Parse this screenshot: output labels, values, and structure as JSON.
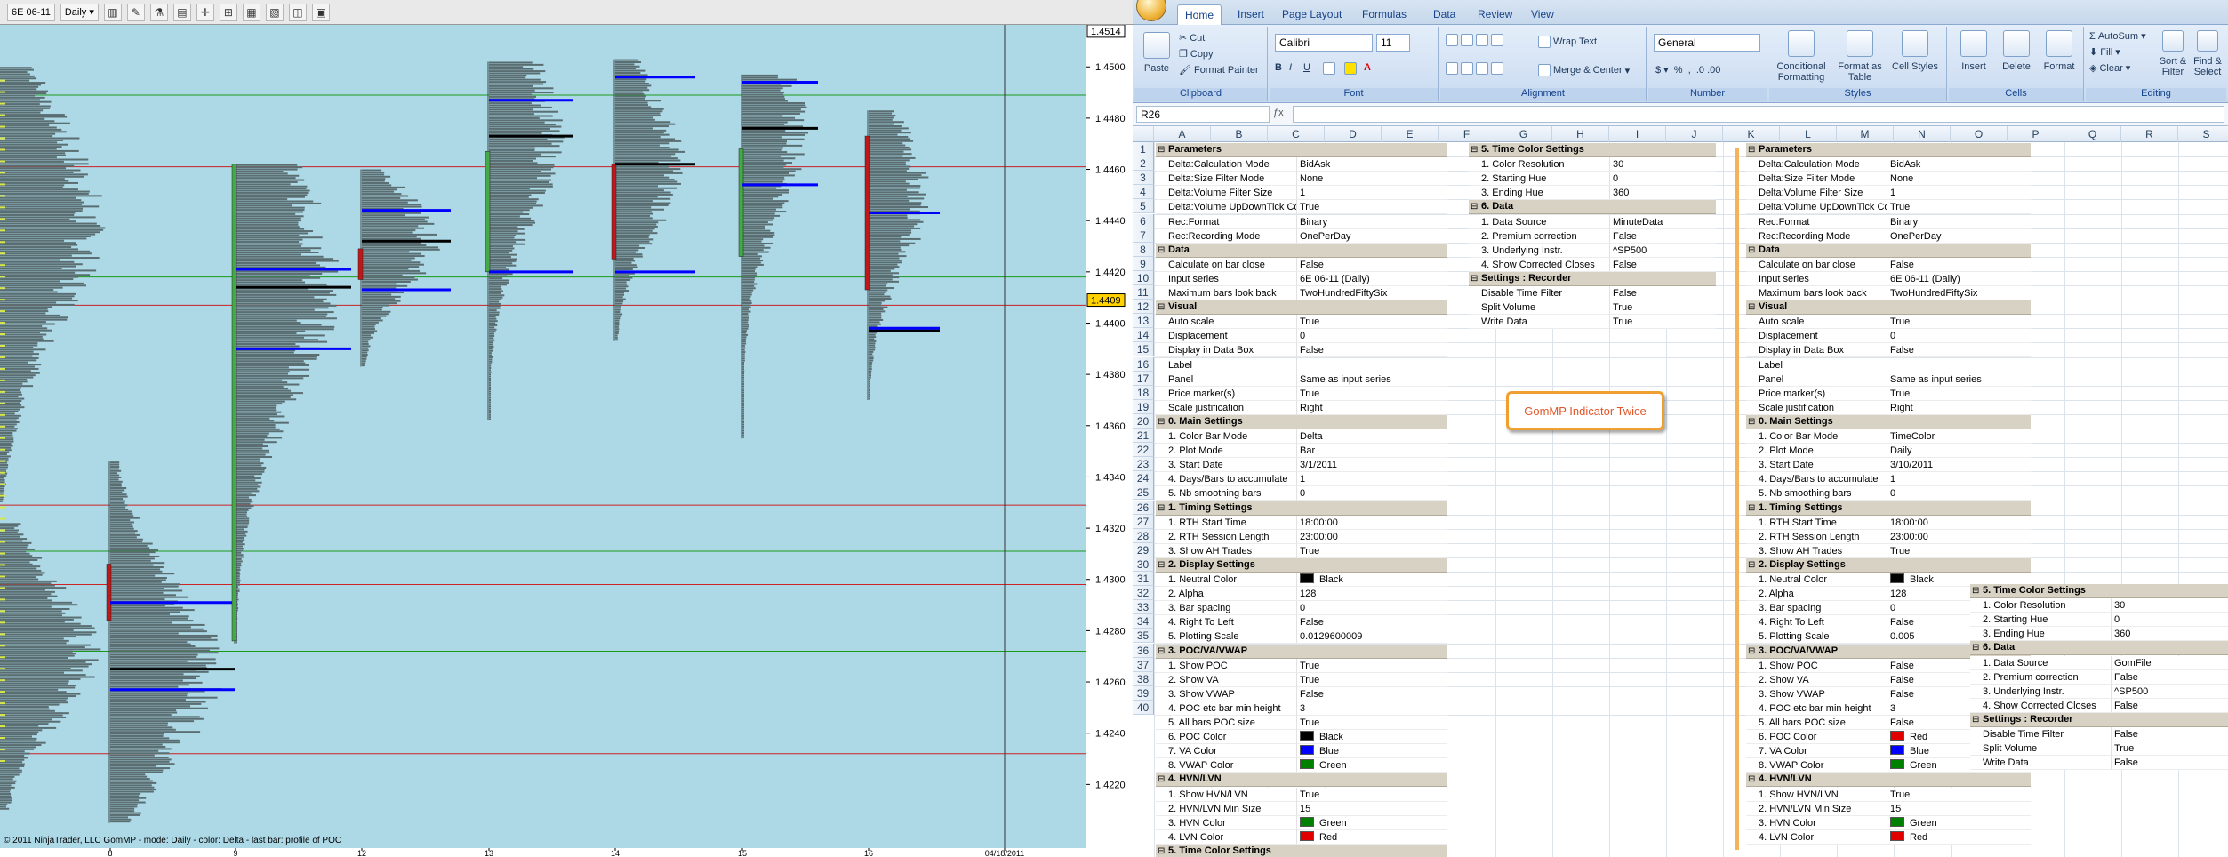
{
  "chart": {
    "instrument": "6E 06-11",
    "period": "Daily",
    "price_axis": [
      "1.4500",
      "1.4480",
      "1.4460",
      "1.4440",
      "1.4420",
      "1.4400",
      "1.4380",
      "1.4360",
      "1.4340",
      "1.4320",
      "1.4300",
      "1.4280",
      "1.4260",
      "1.4240",
      "1.4220"
    ],
    "last_price_top": "1.4514",
    "last_price_marker": "1.4409",
    "date_labels": [
      "8",
      "9",
      "12",
      "13",
      "14",
      "15",
      "16",
      "04/18/2011"
    ],
    "footer": "© 2011 NinjaTrader, LLC  GomMP - mode: Daily - color: Delta - last bar: profile of POC",
    "colors": {
      "plot_bg": "#add8e6",
      "profile": "#5a6e72",
      "poc": "#000000",
      "va": "#0000ff",
      "hline_red": "#cc2222",
      "hline_green": "#1a9a1a"
    }
  },
  "excel": {
    "tabs": [
      "Home",
      "Insert",
      "Page Layout",
      "Formulas",
      "Data",
      "Review",
      "View"
    ],
    "groups": {
      "clipboard": {
        "label": "Clipboard",
        "paste": "Paste",
        "cut": "Cut",
        "copy": "Copy",
        "format_painter": "Format Painter"
      },
      "font": {
        "label": "Font",
        "name": "Calibri",
        "size": "11"
      },
      "alignment": {
        "label": "Alignment",
        "wrap": "Wrap Text",
        "merge": "Merge & Center"
      },
      "number": {
        "label": "Number",
        "format": "General"
      },
      "styles": {
        "label": "Styles",
        "conditional": "Conditional Formatting",
        "format_table": "Format as Table",
        "cell_styles": "Cell Styles"
      },
      "cells": {
        "label": "Cells",
        "insert": "Insert",
        "delete": "Delete",
        "format": "Format"
      },
      "editing": {
        "label": "Editing",
        "autosum": "AutoSum",
        "fill": "Fill",
        "clear": "Clear",
        "sort": "Sort & Filter",
        "find": "Find & Select"
      }
    },
    "name_box": "R26",
    "columns": [
      "A",
      "B",
      "C",
      "D",
      "E",
      "F",
      "G",
      "H",
      "I",
      "J",
      "K",
      "L",
      "M",
      "N",
      "O",
      "P",
      "Q",
      "R",
      "S"
    ],
    "rows": [
      "1",
      "2",
      "3",
      "4",
      "5",
      "6",
      "7",
      "8",
      "9",
      "10",
      "11",
      "12",
      "13",
      "14",
      "15",
      "16",
      "17",
      "18",
      "19",
      "20",
      "21",
      "22",
      "23",
      "24",
      "25",
      "26",
      "27",
      "28",
      "29",
      "30",
      "31",
      "32",
      "33",
      "34",
      "35",
      "36",
      "37",
      "38",
      "39",
      "40"
    ],
    "callout": "GomMP Indicator Twice",
    "panel1": [
      {
        "s": "Parameters"
      },
      {
        "k": "Delta:Calculation Mode",
        "v": "BidAsk"
      },
      {
        "k": "Delta:Size Filter Mode",
        "v": "None"
      },
      {
        "k": "Delta:Volume Filter Size",
        "v": "1"
      },
      {
        "k": "Delta:Volume UpDownTick Com",
        "v": "True"
      },
      {
        "k": "Rec:Format",
        "v": "Binary"
      },
      {
        "k": "Rec:Recording Mode",
        "v": "OnePerDay"
      },
      {
        "s": "Data"
      },
      {
        "k": "Calculate on bar close",
        "v": "False"
      },
      {
        "k": "Input series",
        "v": "6E 06-11 (Daily)"
      },
      {
        "k": "Maximum bars look back",
        "v": "TwoHundredFiftySix"
      },
      {
        "s": "Visual"
      },
      {
        "k": "Auto scale",
        "v": "True"
      },
      {
        "k": "Displacement",
        "v": "0"
      },
      {
        "k": "Display in Data Box",
        "v": "False"
      },
      {
        "k": "Label",
        "v": ""
      },
      {
        "k": "Panel",
        "v": "Same as input series"
      },
      {
        "k": "Price marker(s)",
        "v": "True"
      },
      {
        "k": "Scale justification",
        "v": "Right"
      },
      {
        "s": "0. Main Settings"
      },
      {
        "k": "1. Color Bar Mode",
        "v": "Delta"
      },
      {
        "k": "2. Plot Mode",
        "v": "Bar"
      },
      {
        "k": "3. Start Date",
        "v": "3/1/2011"
      },
      {
        "k": "4. Days/Bars to accumulate",
        "v": "1"
      },
      {
        "k": "5. Nb smoothing bars",
        "v": "0"
      },
      {
        "s": "1. Timing Settings"
      },
      {
        "k": "1. RTH Start Time",
        "v": "18:00:00"
      },
      {
        "k": "2. RTH Session Length",
        "v": "23:00:00"
      },
      {
        "k": "3. Show AH Trades",
        "v": "True"
      },
      {
        "s": "2. Display Settings"
      },
      {
        "k": "1. Neutral Color",
        "v": "Black",
        "c": "#000000"
      },
      {
        "k": "2. Alpha",
        "v": "128"
      },
      {
        "k": "3. Bar spacing",
        "v": "0"
      },
      {
        "k": "4. Right To Left",
        "v": "False"
      },
      {
        "k": "5. Plotting Scale",
        "v": "0.0129600009"
      },
      {
        "s": "3. POC/VA/VWAP"
      },
      {
        "k": "1. Show POC",
        "v": "True"
      },
      {
        "k": "2. Show VA",
        "v": "True"
      },
      {
        "k": "3. Show VWAP",
        "v": "False"
      },
      {
        "k": "4. POC etc bar min height",
        "v": "3"
      },
      {
        "k": "5. All bars POC size",
        "v": "True"
      },
      {
        "k": "6. POC Color",
        "v": "Black",
        "c": "#000000"
      },
      {
        "k": "7. VA Color",
        "v": "Blue",
        "c": "#0000ff"
      },
      {
        "k": "8. VWAP Color",
        "v": "Green",
        "c": "#008000"
      },
      {
        "s": "4. HVN/LVN"
      },
      {
        "k": "1. Show HVN/LVN",
        "v": "True"
      },
      {
        "k": "2. HVN/LVN Min Size",
        "v": "15"
      },
      {
        "k": "3. HVN Color",
        "v": "Green",
        "c": "#008000"
      },
      {
        "k": "4. LVN Color",
        "v": "Red",
        "c": "#e00000"
      },
      {
        "s": "5. Time Color Settings"
      }
    ],
    "panel2": [
      {
        "s": "5. Time Color Settings"
      },
      {
        "k": "1. Color Resolution",
        "v": "30"
      },
      {
        "k": "2. Starting Hue",
        "v": "0"
      },
      {
        "k": "3. Ending Hue",
        "v": "360"
      },
      {
        "s": "6. Data"
      },
      {
        "k": "1. Data Source",
        "v": "MinuteData"
      },
      {
        "k": "2. Premium correction",
        "v": "False"
      },
      {
        "k": "3. Underlying Instr.",
        "v": "^SP500"
      },
      {
        "k": "4. Show Corrected Closes",
        "v": "False"
      },
      {
        "s": "Settings : Recorder"
      },
      {
        "k": "Disable Time Filter",
        "v": "False"
      },
      {
        "k": "Split Volume",
        "v": "True"
      },
      {
        "k": "Write Data",
        "v": "True"
      }
    ],
    "panel3": [
      {
        "s": "Parameters"
      },
      {
        "k": "Delta:Calculation Mode",
        "v": "BidAsk"
      },
      {
        "k": "Delta:Size Filter Mode",
        "v": "None"
      },
      {
        "k": "Delta:Volume Filter Size",
        "v": "1"
      },
      {
        "k": "Delta:Volume UpDownTick Com",
        "v": "True"
      },
      {
        "k": "Rec:Format",
        "v": "Binary"
      },
      {
        "k": "Rec:Recording Mode",
        "v": "OnePerDay"
      },
      {
        "s": "Data"
      },
      {
        "k": "Calculate on bar close",
        "v": "False"
      },
      {
        "k": "Input series",
        "v": "6E 06-11 (Daily)"
      },
      {
        "k": "Maximum bars look back",
        "v": "TwoHundredFiftySix"
      },
      {
        "s": "Visual"
      },
      {
        "k": "Auto scale",
        "v": "True"
      },
      {
        "k": "Displacement",
        "v": "0"
      },
      {
        "k": "Display in Data Box",
        "v": "False"
      },
      {
        "k": "Label",
        "v": ""
      },
      {
        "k": "Panel",
        "v": "Same as input series"
      },
      {
        "k": "Price marker(s)",
        "v": "True"
      },
      {
        "k": "Scale justification",
        "v": "Right"
      },
      {
        "s": "0. Main Settings"
      },
      {
        "k": "1. Color Bar Mode",
        "v": "TimeColor"
      },
      {
        "k": "2. Plot Mode",
        "v": "Daily"
      },
      {
        "k": "3. Start Date",
        "v": "3/10/2011"
      },
      {
        "k": "4. Days/Bars to accumulate",
        "v": "1"
      },
      {
        "k": "5. Nb smoothing bars",
        "v": "0"
      },
      {
        "s": "1. Timing Settings"
      },
      {
        "k": "1. RTH Start Time",
        "v": "18:00:00"
      },
      {
        "k": "2. RTH Session Length",
        "v": "23:00:00"
      },
      {
        "k": "3. Show AH Trades",
        "v": "True"
      },
      {
        "s": "2. Display Settings"
      },
      {
        "k": "1. Neutral Color",
        "v": "Black",
        "c": "#000000"
      },
      {
        "k": "2. Alpha",
        "v": "128"
      },
      {
        "k": "3. Bar spacing",
        "v": "0"
      },
      {
        "k": "4. Right To Left",
        "v": "False"
      },
      {
        "k": "5. Plotting Scale",
        "v": "0.005"
      },
      {
        "s": "3. POC/VA/VWAP"
      },
      {
        "k": "1. Show POC",
        "v": "False"
      },
      {
        "k": "2. Show VA",
        "v": "False"
      },
      {
        "k": "3. Show VWAP",
        "v": "False"
      },
      {
        "k": "4. POC etc bar min height",
        "v": "3"
      },
      {
        "k": "5. All bars POC size",
        "v": "False"
      },
      {
        "k": "6. POC Color",
        "v": "Red",
        "c": "#e00000"
      },
      {
        "k": "7. VA Color",
        "v": "Blue",
        "c": "#0000ff"
      },
      {
        "k": "8. VWAP Color",
        "v": "Green",
        "c": "#008000"
      },
      {
        "s": "4. HVN/LVN"
      },
      {
        "k": "1. Show HVN/LVN",
        "v": "True"
      },
      {
        "k": "2. HVN/LVN Min Size",
        "v": "15"
      },
      {
        "k": "3. HVN Color",
        "v": "Green",
        "c": "#008000"
      },
      {
        "k": "4. LVN Color",
        "v": "Red",
        "c": "#e00000"
      }
    ],
    "panel4": [
      {
        "s": "5. Time Color Settings"
      },
      {
        "k": "1. Color Resolution",
        "v": "30"
      },
      {
        "k": "2. Starting Hue",
        "v": "0"
      },
      {
        "k": "3. Ending Hue",
        "v": "360"
      },
      {
        "s": "6. Data"
      },
      {
        "k": "1. Data Source",
        "v": "GomFile"
      },
      {
        "k": "2. Premium correction",
        "v": "False"
      },
      {
        "k": "3. Underlying Instr.",
        "v": "^SP500"
      },
      {
        "k": "4. Show Corrected Closes",
        "v": "False"
      },
      {
        "s": "Settings : Recorder"
      },
      {
        "k": "Disable Time Filter",
        "v": "False"
      },
      {
        "k": "Split Volume",
        "v": "True"
      },
      {
        "k": "Write Data",
        "v": "False"
      }
    ]
  }
}
